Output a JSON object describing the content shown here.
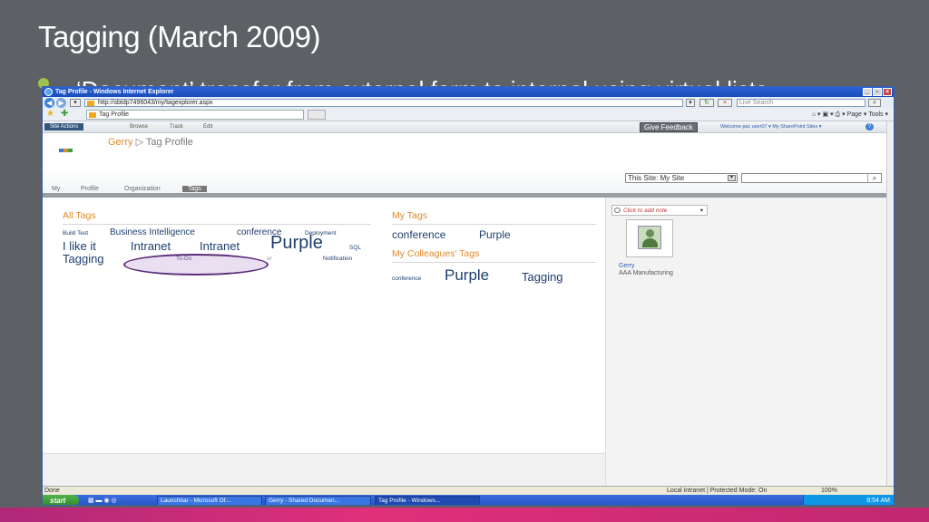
{
  "slide": {
    "title": "Tagging (March 2009)",
    "bullet": "‘Document’ transfer from external form to internal using virtual lists"
  },
  "browser": {
    "window_title": "Tag Profile - Windows Internet Explorer",
    "url": "http://sbtdp7496043/my/tagexplorer.aspx",
    "search_placeholder": "Live Search",
    "tab_title": "Tag Profile",
    "tools": "Page ▾  Tools ▾"
  },
  "sharepoint": {
    "site_actions": "Site Actions",
    "ribbon_tabs": [
      "Browse",
      "Track",
      "Edit"
    ],
    "give_feedback": "Give Feedback",
    "welcome": "Welcome pac user07 ▾    My SharePoint Sites ▾",
    "breadcrumb_user": "Gerry",
    "breadcrumb_sep": "▷",
    "breadcrumb_page": "Tag Profile",
    "scope": "This Site: My Site",
    "nav_tabs": [
      "My",
      "Profile",
      "Organization",
      "Tags"
    ]
  },
  "all_tags": {
    "heading": "All Tags",
    "tags": [
      "Build Test",
      "Business Intelligence",
      "conference",
      "Deployment",
      "I like it",
      "Intranet",
      "Intranet",
      "Purple",
      "SQL",
      "Tagging",
      "To-Do",
      "er",
      "Notification"
    ]
  },
  "my_tags": {
    "heading": "My Tags",
    "tags": [
      "conference",
      "Purple"
    ]
  },
  "colleagues_tags": {
    "heading": "My Colleagues' Tags",
    "tags": [
      "conference",
      "Purple",
      "Tagging"
    ]
  },
  "profile": {
    "note": "Click to add note",
    "name": "Gerry",
    "company": "AAA Manufacturing"
  },
  "status": {
    "done": "Done",
    "zone": "Local intranet | Protected Mode: On",
    "zoom": "100%"
  },
  "taskbar": {
    "start": "start",
    "items": [
      "Launchbar - Microsoft Of...",
      "Gerry - Shared Documen...",
      "Tag Profile - Windows..."
    ],
    "clock": "8:54 AM"
  },
  "colors": {
    "slide_bg": "#5d6165",
    "accent_orange": "#e08a28",
    "tag_navy": "#1e3e6e",
    "highlight": "#5a2e78"
  }
}
